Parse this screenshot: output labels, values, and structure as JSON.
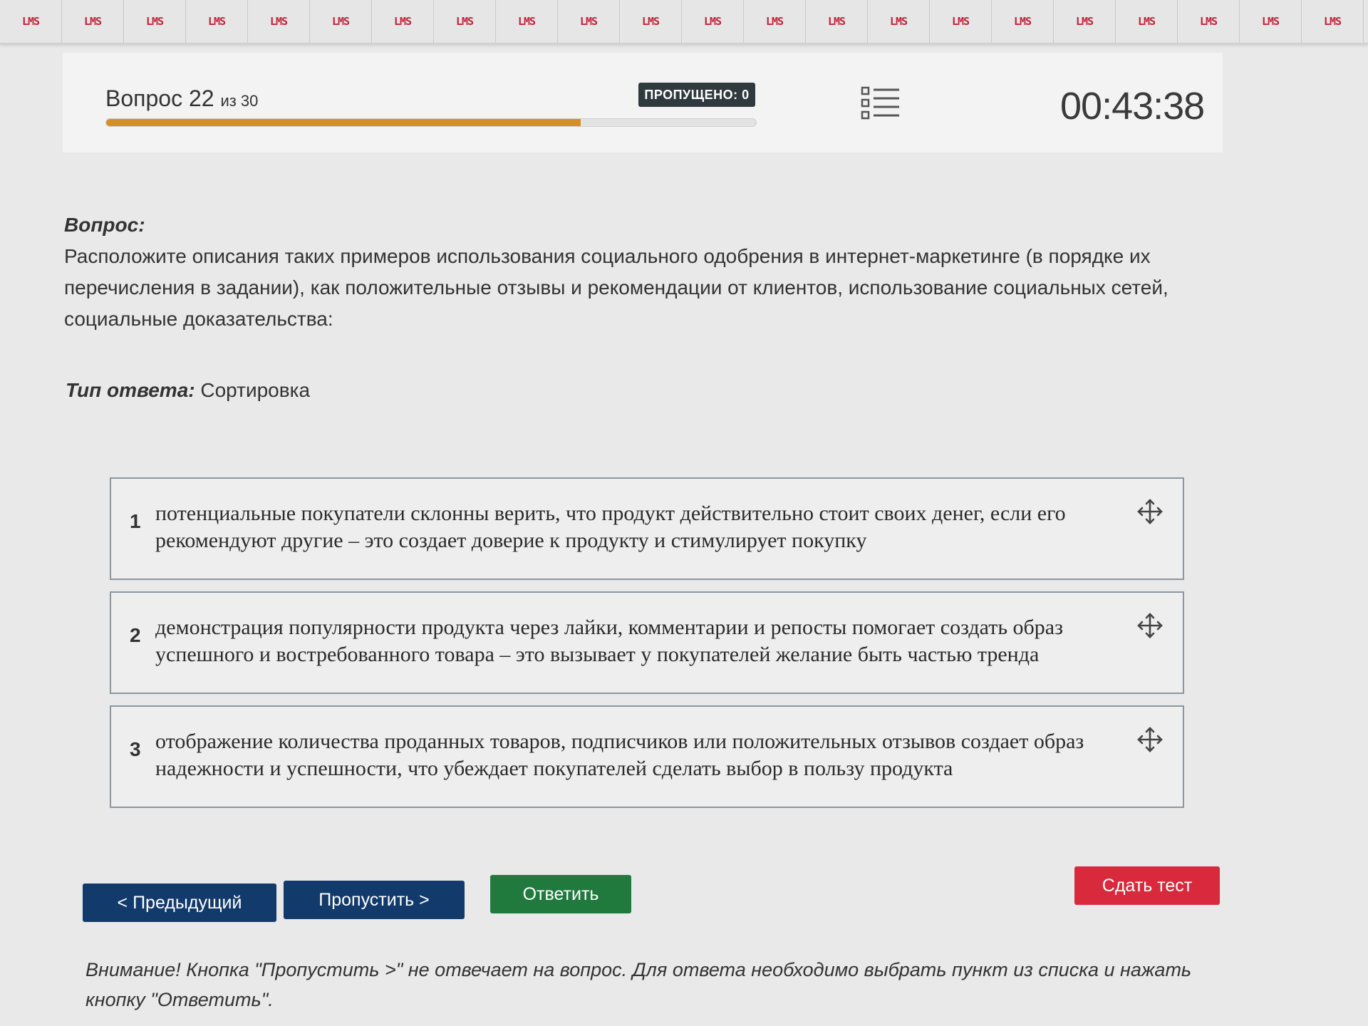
{
  "top_strip": {
    "label": "LMS",
    "count": 23
  },
  "header": {
    "question_word": "Вопрос",
    "question_number": "22",
    "question_total": "из 30",
    "progress_fraction": 0.73,
    "skipped_label": "ПРОПУЩЕНО: 0",
    "timer": "00:43:38"
  },
  "question": {
    "title": "Вопрос:",
    "text": "Расположите описания таких примеров использования социального одобрения в интернет-маркетинге (в порядке их перечисления в задании), как положительные отзывы и рекомендации от клиентов, использование социальных сетей, социальные доказательства:",
    "answer_type_label": "Тип ответа:",
    "answer_type_value": "Сортировка"
  },
  "items": [
    {
      "num": "1",
      "text": "потенциальные покупатели склонны верить, что продукт действительно стоит своих денег, если его рекомендуют другие – это создает доверие к продукту и стимулирует покупку"
    },
    {
      "num": "2",
      "text": "демонстрация популярности продукта через лайки, комментарии и репосты помогает создать образ успешного и востребованного товара – это вызывает у покупателей желание быть частью тренда"
    },
    {
      "num": "3",
      "text": "отображение количества проданных товаров, подписчиков или положительных отзывов создает образ надежности и успешности, что убеждает покупателей сделать выбор в пользу продукта"
    }
  ],
  "buttons": {
    "prev": "< Предыдущий",
    "skip": "Пропустить >",
    "answer": "Ответить",
    "submit": "Сдать тест"
  },
  "note": "Внимание! Кнопка \"Пропустить >\" не отвечает на вопрос. Для ответа необходимо выбрать пункт из списка и нажать кнопку \"Ответить\".",
  "colors": {
    "progress": "#d68f26",
    "nav_button": "#123a6b",
    "answer_button": "#207a3e",
    "submit_button": "#d8293d",
    "lms_text": "#c0243a"
  }
}
